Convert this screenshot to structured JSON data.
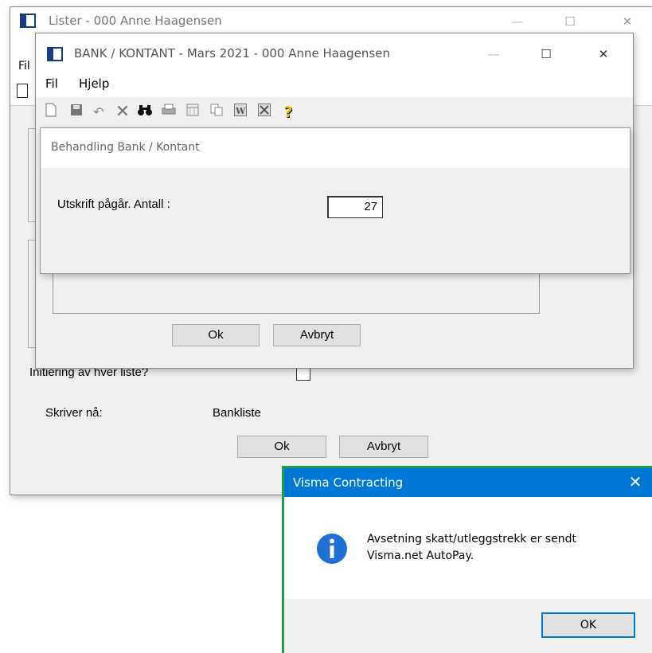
{
  "lister_window": {
    "title": "Lister - 000 Anne Haagensen",
    "menu_partial": "Fil",
    "initiering_label": "Initiering av hver liste?",
    "skriver_label": "Skriver nå:",
    "skriver_value": "Bankliste",
    "ok_label": "Ok",
    "avbryt_label": "Avbryt"
  },
  "bank_window": {
    "title": "BANK / KONTANT - Mars 2021 - 000 Anne Haagensen",
    "menu": [
      "Fil",
      "Hjelp"
    ],
    "toolbar_icons": [
      "new-document-icon",
      "save-icon",
      "undo-icon",
      "delete-icon",
      "binoculars-icon",
      "print-icon",
      "calendar-icon",
      "copy-icon",
      "word-icon",
      "excel-icon",
      "help-icon"
    ],
    "ok_label": "Ok",
    "avbryt_label": "Avbryt"
  },
  "progress_dialog": {
    "title": "Behandling Bank / Kontant",
    "label": "Utskrift pågår. Antall :",
    "count": "27"
  },
  "visma_dialog": {
    "title": "Visma Contracting",
    "message_line1": "Avsetning skatt/utleggstrekk er sendt",
    "message_line2": "Visma.net AutoPay.",
    "ok_label": "OK",
    "accent_color": "#1aa04a",
    "titlebar_color": "#0078d7"
  },
  "caption_symbols": {
    "minimize": "—",
    "maximize": "☐",
    "close": "✕"
  }
}
